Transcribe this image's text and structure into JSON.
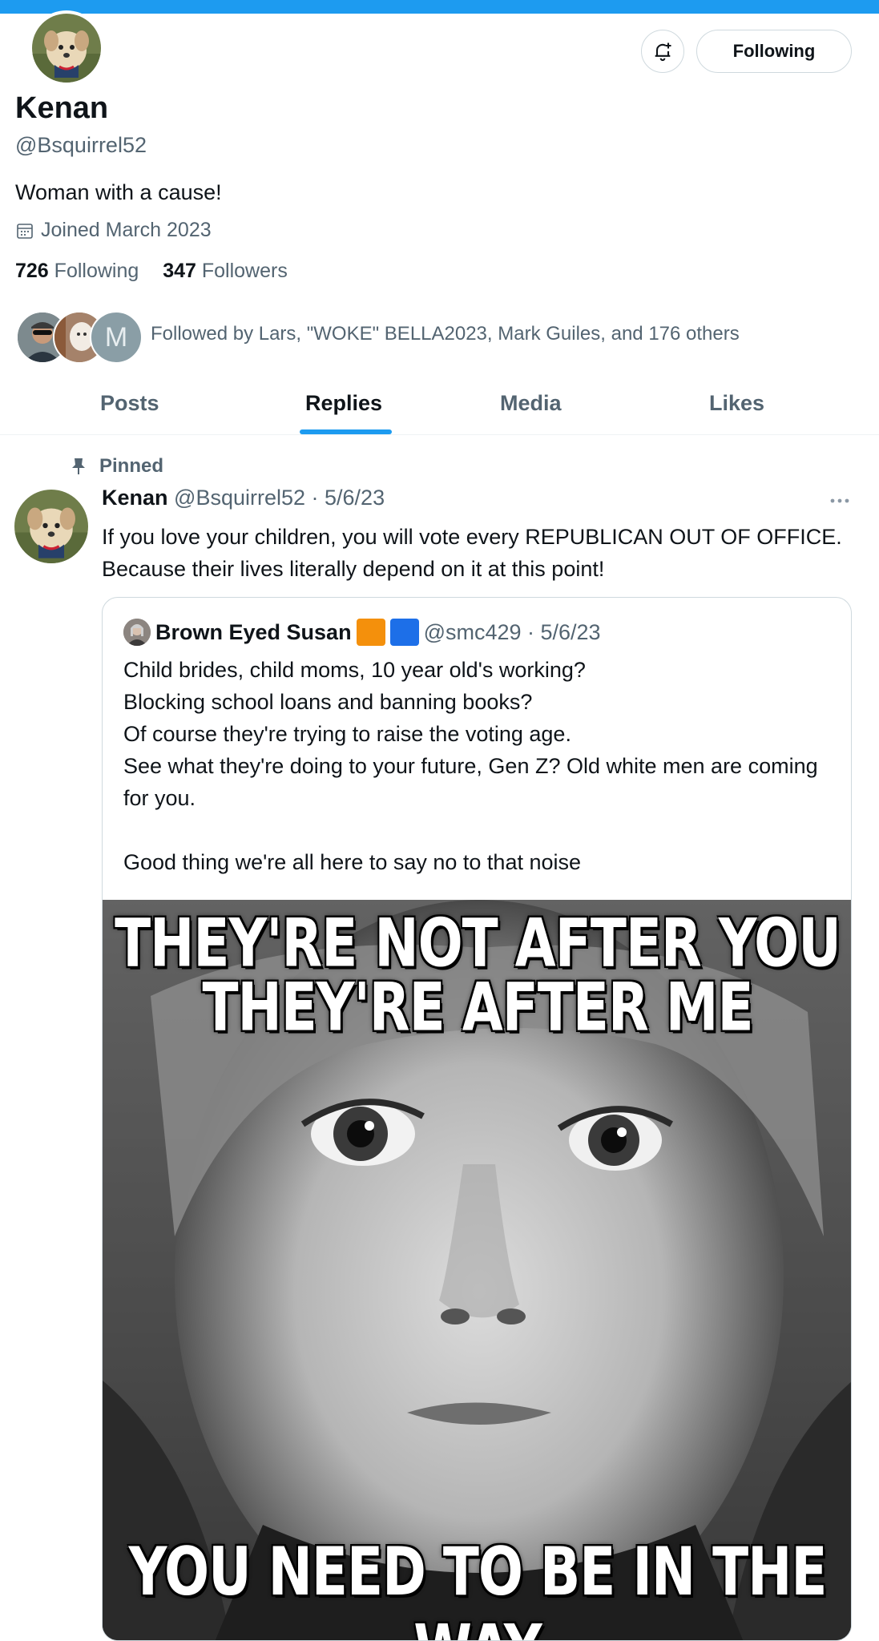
{
  "profile": {
    "name": "Kenan",
    "handle": "@Bsquirrel52",
    "bio": "Woman with a cause!",
    "joined": "Joined March 2023",
    "following_count": "726",
    "following_label": "Following",
    "followers_count": "347",
    "followers_label": "Followers",
    "followed_by": "Followed by Lars, \"WOKE\" BELLA2023, Mark Guiles, and 176 others",
    "followed_by_initial": "M"
  },
  "actions": {
    "following_button": "Following"
  },
  "tabs": [
    {
      "label": "Posts",
      "active": false
    },
    {
      "label": "Replies",
      "active": true
    },
    {
      "label": "Media",
      "active": false
    },
    {
      "label": "Likes",
      "active": false
    }
  ],
  "pinned_label": "Pinned",
  "tweet": {
    "author": "Kenan",
    "meta": "@Bsquirrel52 · 5/6/23",
    "text": "If you love your children, you will vote every REPUBLICAN OUT OF OFFICE. Because their lives literally depend on it at this point!"
  },
  "quote": {
    "author": "Brown Eyed Susan",
    "meta": "@smc429 · 5/6/23",
    "lines": [
      "Child brides, child moms, 10 year old's working?",
      "Blocking school loans and banning books?",
      "Of course they're trying to raise the voting age.",
      "See what they're doing to your future, Gen Z? Old white men are coming for you.",
      "",
      "Good thing we're all here to say no to that noise"
    ],
    "flag_colors": [
      "#f4900c",
      "#1d6fe8"
    ]
  },
  "meme": {
    "line1": "THEY'RE NOT AFTER YOU",
    "line2": "THEY'RE AFTER ME",
    "line3": "YOU NEED TO BE IN THE WAY"
  },
  "colors": {
    "accent": "#1d9bf0",
    "secondary_text": "#536471",
    "border": "#cfd9de"
  }
}
